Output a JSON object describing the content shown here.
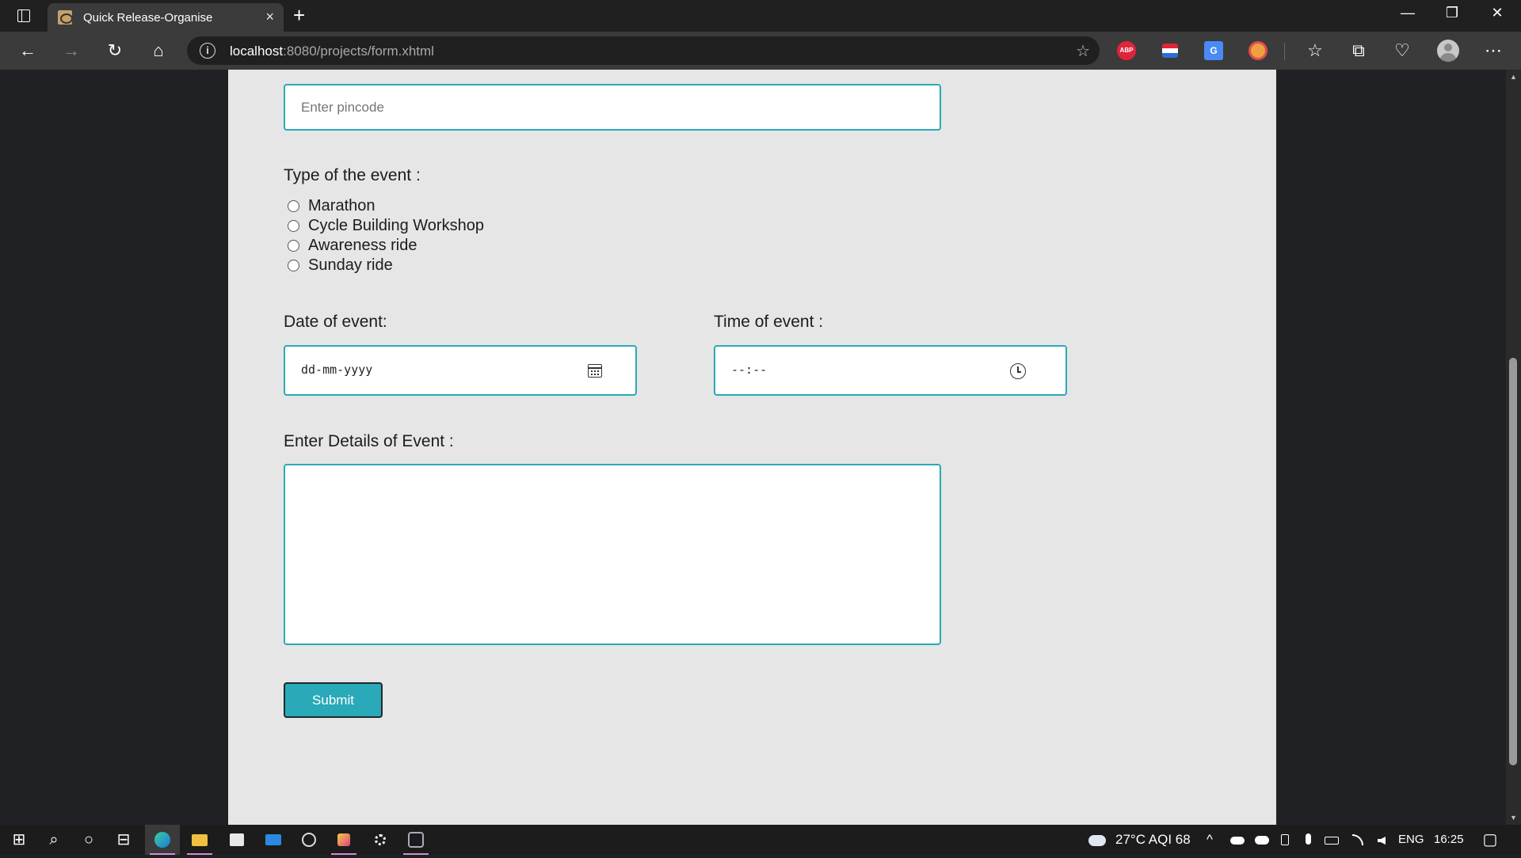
{
  "browser": {
    "tab_title": "Quick Release-Organise",
    "tab_close": "×",
    "new_tab": "+",
    "address_host": "localhost",
    "address_path": ":8080/projects/form.xhtml",
    "ext_abp": "ABP",
    "ext_translate": "G",
    "win_minimize": "—",
    "win_restore": "❐",
    "win_close": "✕",
    "back": "←",
    "forward": "→",
    "reload": "↻",
    "home": "⌂",
    "favorite": "☆",
    "favorites": "☆",
    "collections": "⧉",
    "browser_essentials": "♡",
    "more": "⋯"
  },
  "form": {
    "pincode_placeholder": "Enter pincode",
    "event_type_label": "Type of the event :",
    "event_types": [
      "Marathon",
      "Cycle Building Workshop",
      "Awareness ride",
      "Sunday ride"
    ],
    "date_label": "Date of event:",
    "date_placeholder": "dd-mm-yyyy",
    "time_label": "Time of event :",
    "time_placeholder": "--:--",
    "details_label": "Enter Details of Event :",
    "details_value": "",
    "submit_label": "Submit"
  },
  "taskbar": {
    "start": "⊞",
    "search": "⌕",
    "cortana": "○",
    "task_view": "⊟",
    "weather": "27°C  AQI 68",
    "tray_chevron": "^",
    "language": "ENG",
    "time": "16:25",
    "notifications": "▢"
  },
  "colors": {
    "accent": "#2aa9b8",
    "page_bg": "#e6e6e6",
    "chrome_bg": "#202020"
  }
}
